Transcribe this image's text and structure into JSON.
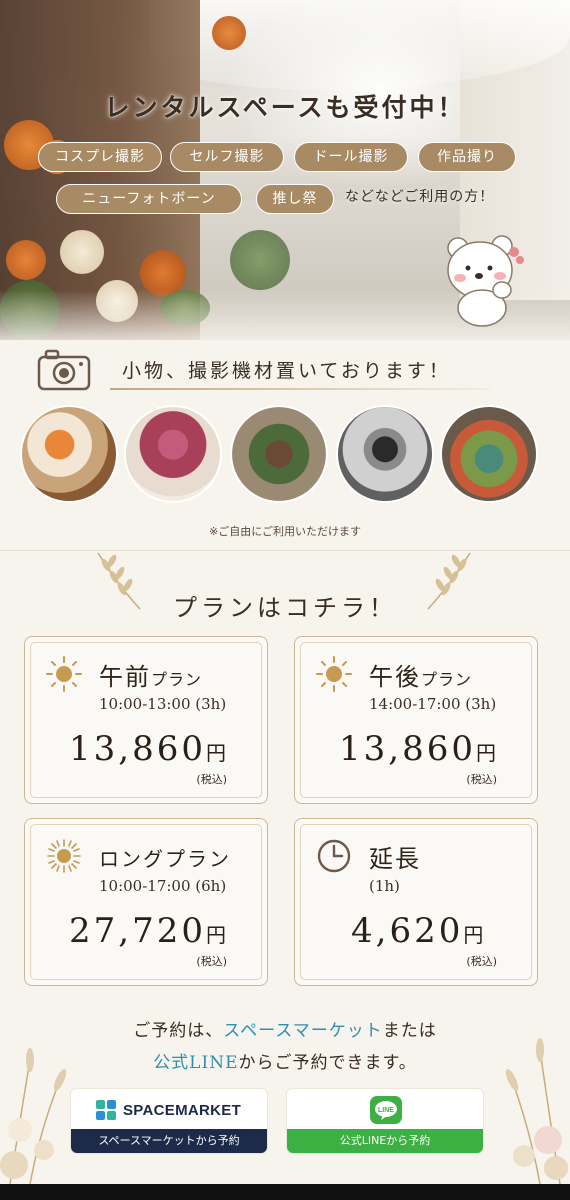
{
  "hero": {
    "title": "レンタルスペースも受付中！",
    "tags": [
      "コスプレ撮影",
      "セルフ撮影",
      "ドール撮影",
      "作品撮り",
      "ニューフォトボーン",
      "推し祭"
    ],
    "etc": "などなどご利用の方！"
  },
  "equipment": {
    "title": "小物、撮影機材置いております！",
    "note": "※ご自由にご利用いただけます"
  },
  "plans": {
    "title": "プランはコチラ！",
    "items": [
      {
        "name": "午前",
        "suffix": "プラン",
        "time": "10:00-13:00 (3h)",
        "price": "13,860",
        "yen": "円",
        "tax": "(税込)"
      },
      {
        "name": "午後",
        "suffix": "プラン",
        "time": "14:00-17:00 (3h)",
        "price": "13,860",
        "yen": "円",
        "tax": "(税込)"
      },
      {
        "name": "ロングプラン",
        "suffix": "",
        "time": "10:00-17:00 (6h)",
        "price": "27,720",
        "yen": "円",
        "tax": "(税込)"
      },
      {
        "name": "延長",
        "suffix": "",
        "time": "(1h)",
        "price": "4,620",
        "yen": "円",
        "tax": "(税込)"
      }
    ]
  },
  "reservation": {
    "line1_a": "ご予約は、",
    "line1_b": "スペースマーケット",
    "line1_c": "または",
    "line2_a": "公式LINE",
    "line2_b": "からご予約できます。",
    "spacemarket_logo": "SPACEMARKET",
    "spacemarket_button": "スペースマーケットから予約",
    "line_logo": "LINE",
    "line_button": "公式LINEから予約"
  },
  "colors": {
    "pill": "#a88b64",
    "spacemarket_bar": "#1d2a4a",
    "line_bar": "#3cb043",
    "highlight": "#2f8fb0"
  }
}
